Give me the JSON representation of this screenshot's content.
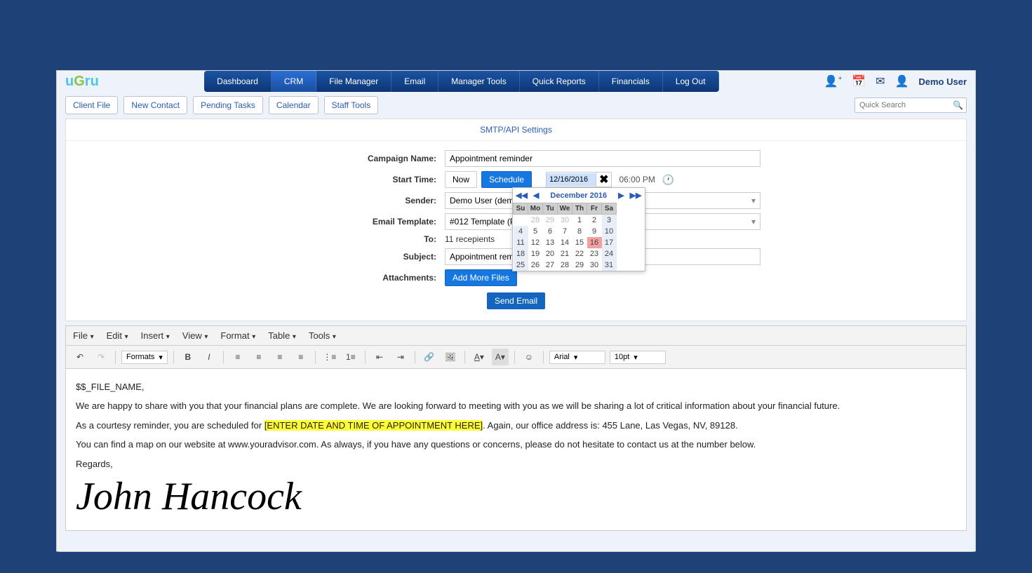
{
  "logo_part1": "u",
  "logo_part2": "G",
  "logo_part3": "ru",
  "nav": [
    "Dashboard",
    "CRM",
    "File Manager",
    "Email",
    "Manager Tools",
    "Quick Reports",
    "Financials",
    "Log Out"
  ],
  "nav_active_index": 1,
  "user_name": "Demo User",
  "subtabs": [
    "Client File",
    "New Contact",
    "Pending Tasks",
    "Calendar",
    "Staff Tools"
  ],
  "quick_search_placeholder": "Quick Search",
  "panel_title": "SMTP/API Settings",
  "form": {
    "campaign_label": "Campaign Name:",
    "campaign_value": "Appointment reminder",
    "start_label": "Start Time:",
    "now_btn": "Now",
    "schedule_btn": "Schedule",
    "date_value": "12/16/2016",
    "time_value": "06:00 PM",
    "sender_label": "Sender:",
    "sender_value": "Demo User (demo@",
    "template_label": "Email Template:",
    "template_value": "#012 Template (PR R",
    "to_label": "To:",
    "to_value": "11 recepients",
    "subject_label": "Subject:",
    "subject_value": "Appointment remind",
    "attach_label": "Attachments:",
    "addfiles_btn": "Add More Files",
    "send_btn": "Send Email"
  },
  "datepicker": {
    "month_label": "December 2016",
    "dow": [
      "Su",
      "Mo",
      "Tu",
      "We",
      "Th",
      "Fr",
      "Sa"
    ],
    "rows": [
      [
        {
          "v": "",
          "o": true
        },
        {
          "v": "28",
          "o": true
        },
        {
          "v": "29",
          "o": true
        },
        {
          "v": "30",
          "o": true
        },
        {
          "v": "1"
        },
        {
          "v": "2"
        },
        {
          "v": "3",
          "w": true
        }
      ],
      [
        {
          "v": "4",
          "w": true
        },
        {
          "v": "5"
        },
        {
          "v": "6"
        },
        {
          "v": "7"
        },
        {
          "v": "8"
        },
        {
          "v": "9"
        },
        {
          "v": "10",
          "w": true
        }
      ],
      [
        {
          "v": "11",
          "w": true
        },
        {
          "v": "12"
        },
        {
          "v": "13"
        },
        {
          "v": "14"
        },
        {
          "v": "15"
        },
        {
          "v": "16",
          "sel": true
        },
        {
          "v": "17",
          "w": true
        }
      ],
      [
        {
          "v": "18",
          "w": true
        },
        {
          "v": "19"
        },
        {
          "v": "20"
        },
        {
          "v": "21"
        },
        {
          "v": "22"
        },
        {
          "v": "23"
        },
        {
          "v": "24",
          "w": true
        }
      ],
      [
        {
          "v": "25",
          "w": true
        },
        {
          "v": "26"
        },
        {
          "v": "27"
        },
        {
          "v": "28"
        },
        {
          "v": "29"
        },
        {
          "v": "30"
        },
        {
          "v": "31",
          "w": true
        }
      ]
    ]
  },
  "editor": {
    "menus": [
      "File",
      "Edit",
      "Insert",
      "View",
      "Format",
      "Table",
      "Tools"
    ],
    "formats_label": "Formats",
    "font_name": "Arial",
    "font_size": "10pt",
    "body_line1": "$$_FILE_NAME,",
    "body_line2": "We are happy to share with you that your financial plans are complete. We are looking forward to meeting with you as we will be sharing a lot of critical information about your financial future.",
    "body_line3a": "As a courtesy reminder, you are scheduled for ",
    "body_line3_hl": "[ENTER DATE AND TIME OF APPOINTMENT HERE]",
    "body_line3b": ". Again, our office address is: 455 Lane, Las Vegas, NV, 89128.",
    "body_line4": "You can find a map on our website at www.youradvisor.com. As always, if you have any questions or concerns, please do not hesitate to contact us at the number below.",
    "body_line5": "Regards,",
    "signature": "John Hancock"
  }
}
